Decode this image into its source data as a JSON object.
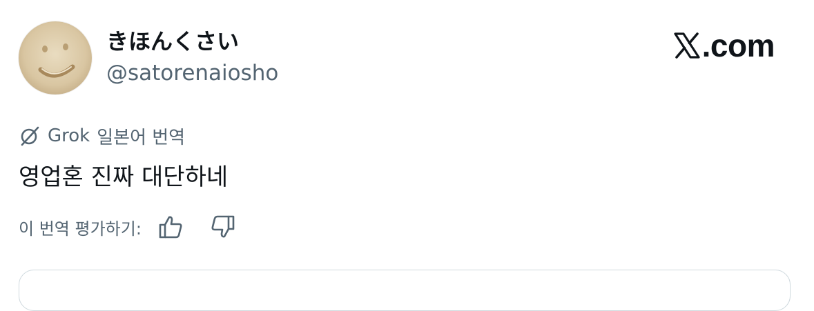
{
  "user": {
    "display_name": "きほんくさい",
    "handle": "@satorenaiosho",
    "avatar_icon": "smiley-face-avatar"
  },
  "brand": {
    "icon": "x-logo-icon",
    "text": ".com"
  },
  "translation": {
    "icon": "grok-icon",
    "provider": "Grok",
    "label": "일본어 번역"
  },
  "tweet": {
    "text": "영업혼 진짜 대단하네"
  },
  "rating": {
    "label": "이 번역 평가하기:",
    "up_icon": "thumbs-up-icon",
    "down_icon": "thumbs-down-icon"
  },
  "colors": {
    "text_primary": "#0f1419",
    "text_secondary": "#536471",
    "border": "#cfd9de"
  }
}
